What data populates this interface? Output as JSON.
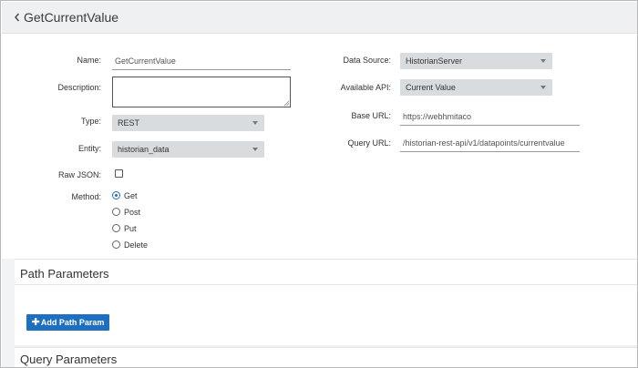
{
  "header": {
    "title": "GetCurrentValue"
  },
  "form": {
    "name": {
      "label": "Name:",
      "value": "GetCurrentValue"
    },
    "description": {
      "label": "Description:",
      "value": ""
    },
    "type": {
      "label": "Type:",
      "value": "REST"
    },
    "entity": {
      "label": "Entity:",
      "value": "historian_data"
    },
    "raw_json": {
      "label": "Raw JSON:",
      "checked": false
    },
    "method": {
      "label": "Method:",
      "options": [
        "Get",
        "Post",
        "Put",
        "Delete"
      ],
      "selected": "Get"
    },
    "data_source": {
      "label": "Data Source:",
      "value": "HistorianServer"
    },
    "available_api": {
      "label": "Available API:",
      "value": "Current Value"
    },
    "base_url": {
      "label": "Base URL:",
      "value": "https://webhmitaco"
    },
    "query_url": {
      "label": "Query URL:",
      "value": "/historian-rest-api/v1/datapoints/currentvalue"
    }
  },
  "path_parameters": {
    "title": "Path Parameters",
    "add_button": "Add Path Param",
    "add_icon": "plus-icon"
  },
  "query_parameters": {
    "title": "Query Parameters"
  },
  "colors": {
    "accent": "#1f6fc1",
    "topbar": "#eef0f2",
    "select_bg": "#d9dcdf"
  }
}
